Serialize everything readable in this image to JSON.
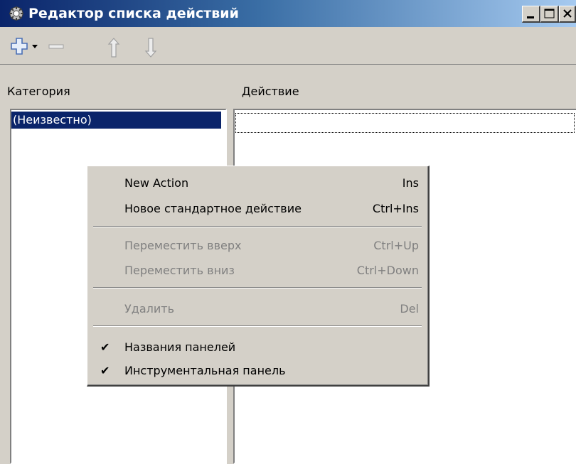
{
  "window": {
    "title": "Редактор списка действий",
    "icon": "app-gear-icon",
    "controls": [
      "minimize-icon",
      "maximize-icon",
      "close-icon"
    ]
  },
  "toolbar": {
    "buttons": [
      {
        "name": "add",
        "icon": "plus-icon",
        "has_dropdown": true
      },
      {
        "name": "remove",
        "icon": "minus-icon"
      },
      {
        "name": "move-up",
        "icon": "arrow-up-icon"
      },
      {
        "name": "move-down",
        "icon": "arrow-down-icon"
      }
    ]
  },
  "columns": {
    "category_header": "Категория",
    "action_header": "Действие"
  },
  "categories": [
    {
      "label": "(Неизвестно)",
      "selected": true
    }
  ],
  "context_menu": {
    "items": [
      {
        "label": "New Action",
        "shortcut": "Ins",
        "enabled": true
      },
      {
        "label": "Новое стандартное действие",
        "shortcut": "Ctrl+Ins",
        "enabled": true
      },
      {
        "label": "Переместить вверх",
        "shortcut": "Ctrl+Up",
        "enabled": false
      },
      {
        "label": "Переместить вниз",
        "shortcut": "Ctrl+Down",
        "enabled": false
      },
      {
        "label": "Удалить",
        "shortcut": "Del",
        "enabled": false
      },
      {
        "label": "Названия панелей",
        "checked": true,
        "enabled": true
      },
      {
        "label": "Инструментальная панель",
        "checked": true,
        "enabled": true
      }
    ]
  },
  "colors": {
    "selection": "#0a246a",
    "face": "#d4d0c8",
    "disabled_text": "#808080"
  }
}
